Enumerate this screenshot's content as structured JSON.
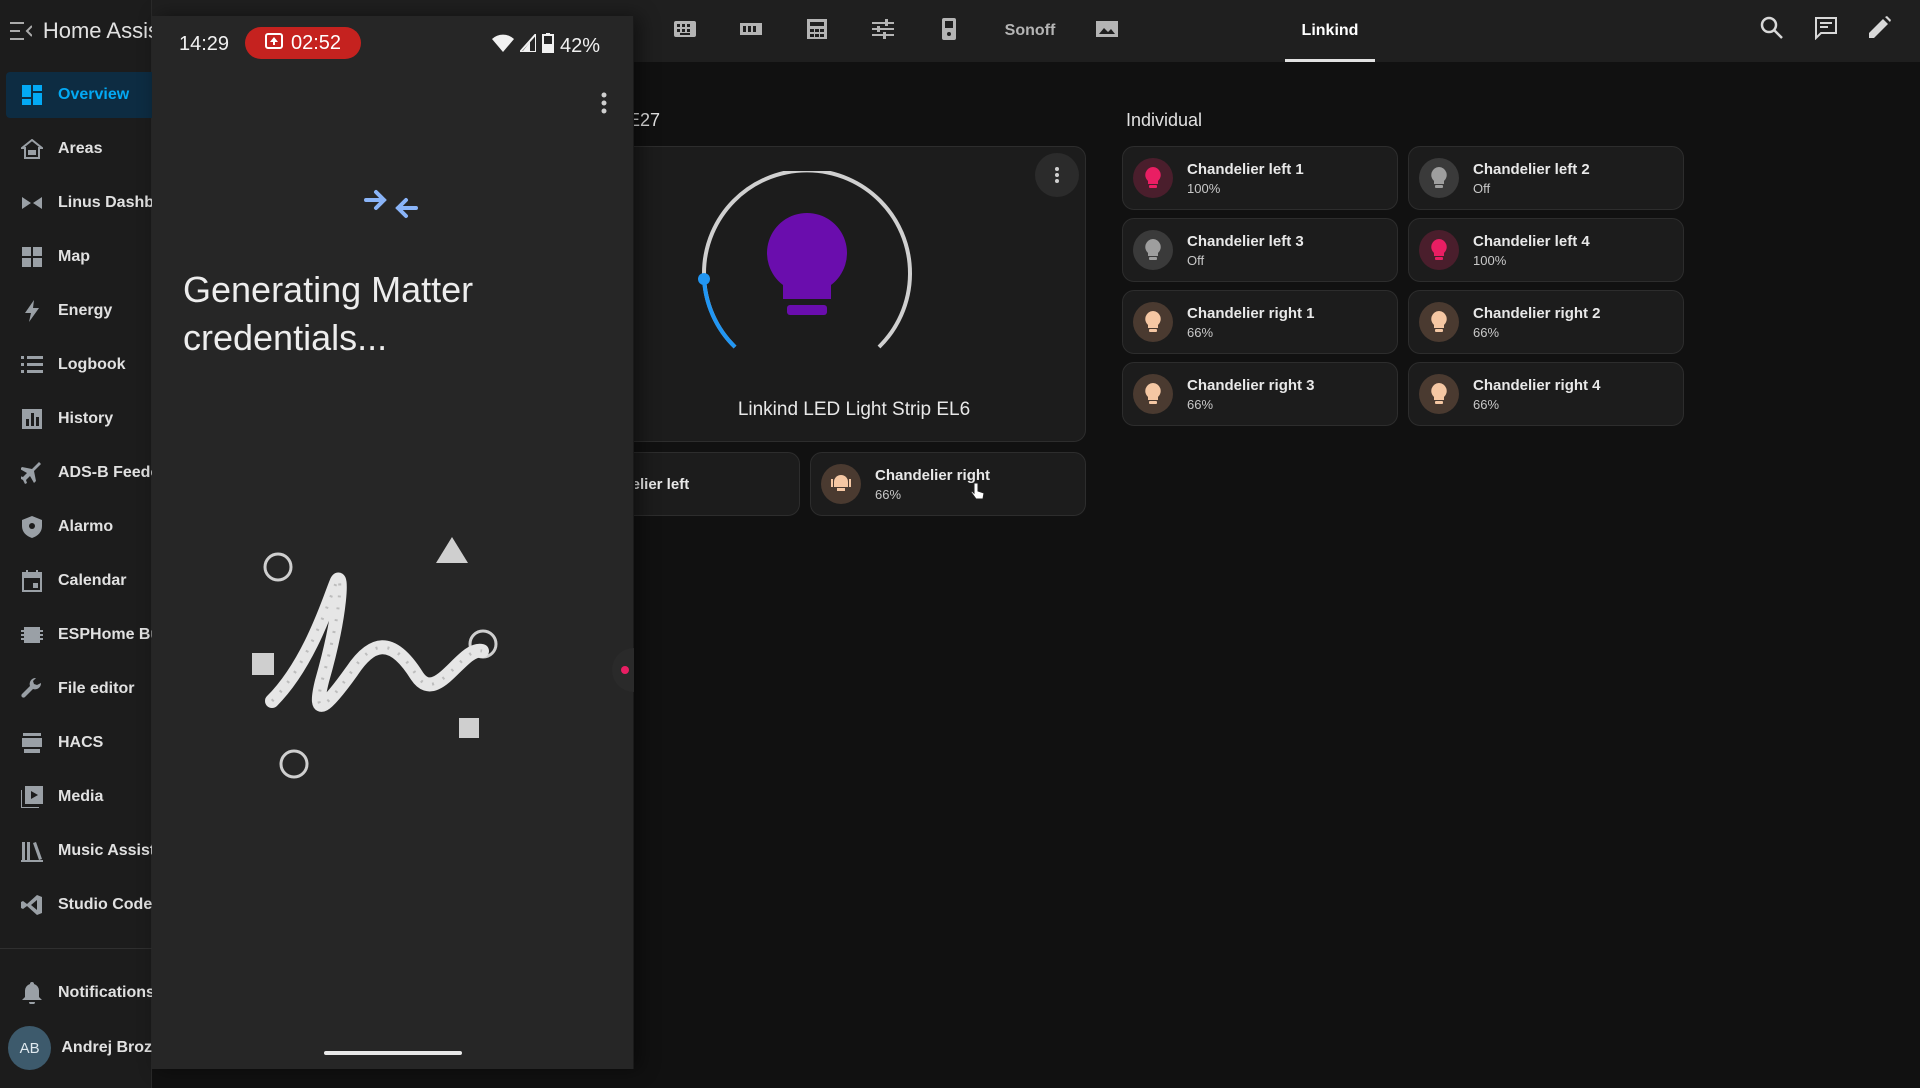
{
  "sidebar": {
    "app_title": "Home Assistant",
    "items": [
      {
        "label": "Overview",
        "icon": "dashboard-grid-icon"
      },
      {
        "label": "Areas",
        "icon": "sofa-icon"
      },
      {
        "label": "Linus Dashboard",
        "icon": "bowtie-icon"
      },
      {
        "label": "Map",
        "icon": "map-icon"
      },
      {
        "label": "Energy",
        "icon": "lightning-icon"
      },
      {
        "label": "Logbook",
        "icon": "list-icon"
      },
      {
        "label": "History",
        "icon": "chart-bars-icon"
      },
      {
        "label": "ADS-B Feeder",
        "icon": "airplane-icon"
      },
      {
        "label": "Alarmo",
        "icon": "shield-icon"
      },
      {
        "label": "Calendar",
        "icon": "calendar-icon"
      },
      {
        "label": "ESPHome Builder",
        "icon": "chip-icon"
      },
      {
        "label": "File editor",
        "icon": "wrench-icon"
      },
      {
        "label": "HACS",
        "icon": "hacs-icon"
      },
      {
        "label": "Media",
        "icon": "media-icon"
      },
      {
        "label": "Music Assistant",
        "icon": "library-icon"
      },
      {
        "label": "Studio Code Server",
        "icon": "vscode-icon"
      }
    ],
    "notifications_label": "Notifications",
    "user": {
      "initials": "AB",
      "name": "Andrej Broz"
    }
  },
  "toolbar": {
    "tabs": [
      {
        "label": "",
        "icon": "keyboard-icon"
      },
      {
        "label": "",
        "icon": "memory-icon"
      },
      {
        "label": "",
        "icon": "calculator-icon"
      },
      {
        "label": "",
        "icon": "tune-icon"
      },
      {
        "label": "",
        "icon": "remote-icon"
      },
      {
        "label": "Sonoff",
        "icon": ""
      },
      {
        "label": "",
        "icon": "image-icon"
      },
      {
        "label": "Linkind",
        "icon": ""
      }
    ],
    "active_tab": "Linkind"
  },
  "dashboard": {
    "group_title_partial": "E27",
    "light_card_name": "Linkind LED Light Strip EL6",
    "light_card_color": "#6a0dad",
    "group_tiles": [
      {
        "name": "Chandelier left",
        "state": ""
      },
      {
        "name": "Chandelier right",
        "state": "66%"
      }
    ],
    "individual_title": "Individual",
    "individual_tiles": [
      {
        "name": "Chandelier left 1",
        "state": "100%",
        "color": "#e91e63"
      },
      {
        "name": "Chandelier left 2",
        "state": "Off",
        "color": "#9e9e9e"
      },
      {
        "name": "Chandelier left 3",
        "state": "Off",
        "color": "#9e9e9e"
      },
      {
        "name": "Chandelier left 4",
        "state": "100%",
        "color": "#e91e63"
      },
      {
        "name": "Chandelier right 1",
        "state": "66%",
        "color": "#f5c7a3"
      },
      {
        "name": "Chandelier right 2",
        "state": "66%",
        "color": "#f5c7a3"
      },
      {
        "name": "Chandelier right 3",
        "state": "66%",
        "color": "#f5c7a3"
      },
      {
        "name": "Chandelier right 4",
        "state": "66%",
        "color": "#f5c7a3"
      }
    ]
  },
  "phone": {
    "time": "14:29",
    "recording_timer": "02:52",
    "battery": "42%",
    "heading": "Generating Matter credentials..."
  }
}
